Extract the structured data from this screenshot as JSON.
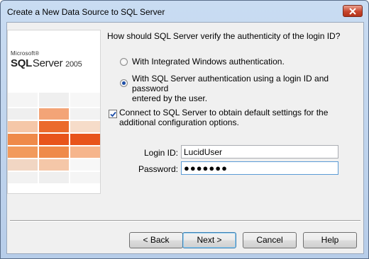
{
  "window": {
    "title": "Create a New Data Source to SQL Server"
  },
  "logo": {
    "microsoft": "Microsoft®",
    "sql": "SQL",
    "server": "Server",
    "version": "2005"
  },
  "question": "How should SQL Server verify the authenticity of the login ID?",
  "auth_options": [
    {
      "label": "With Integrated Windows authentication.",
      "selected": false
    },
    {
      "label_line1": "With SQL Server authentication using a login ID and password",
      "label_line2": "entered by the user.",
      "selected": true
    }
  ],
  "connect_checkbox": {
    "line1": "Connect to SQL Server to obtain default settings for the",
    "line2": "additional configuration options.",
    "checked": true
  },
  "login": {
    "label": "Login ID:",
    "value": "LucidUser"
  },
  "password": {
    "label": "Password:",
    "masked_value": "●●●●●●●"
  },
  "buttons": {
    "back": "< Back",
    "next": "Next >",
    "cancel": "Cancel",
    "help": "Help"
  },
  "colors": {
    "accent_orange": "#e8541b",
    "light_orange": "#f29a5c",
    "radio_dot": "#1d4ea8"
  }
}
